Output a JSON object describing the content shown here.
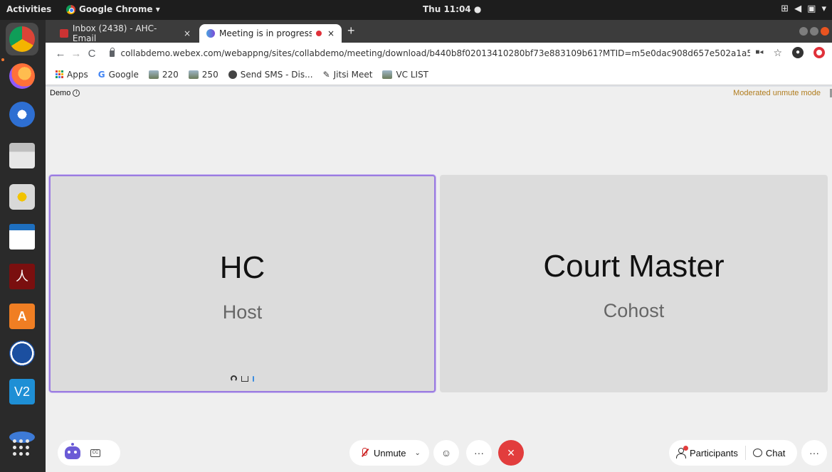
{
  "topbar": {
    "activities": "Activities",
    "app_name": "Google Chrome ▾",
    "clock": "Thu 11:04 ●",
    "tray_icons": [
      "network-icon",
      "volume-icon",
      "battery-icon",
      "power-menu-icon"
    ]
  },
  "browser": {
    "tabs": [
      {
        "title": "Inbox (2438) - AHC-Email",
        "close": "×"
      },
      {
        "title": "Meeting is in progress",
        "close": "×"
      }
    ],
    "new_tab": "+",
    "url": "collabdemo.webex.com/webappng/sites/collabdemo/meeting/download/b440b8f02013410280bf73e883109b61?MTID=m5e0dac908d657e502a1a5913668f...",
    "bookmarks": [
      "Apps",
      "Google",
      "220",
      "250",
      "Send SMS - Dis...",
      "Jitsi Meet",
      "VC LIST"
    ]
  },
  "meeting": {
    "title": "Demo",
    "mode": "Moderated unmute mode",
    "tiles": [
      {
        "name": "HC",
        "role": "Host"
      },
      {
        "name": "Court Master",
        "role": "Cohost"
      }
    ]
  },
  "controls": {
    "unmute": "Unmute",
    "participants": "Participants",
    "chat": "Chat",
    "more": "···",
    "leave": "×",
    "emoji": "☺"
  },
  "colors": {
    "active_speaker_border": "#9b7ce0",
    "leave_button": "#e23d3d",
    "mode_text": "#b07c1d",
    "ubuntu_accent": "#e95420"
  }
}
